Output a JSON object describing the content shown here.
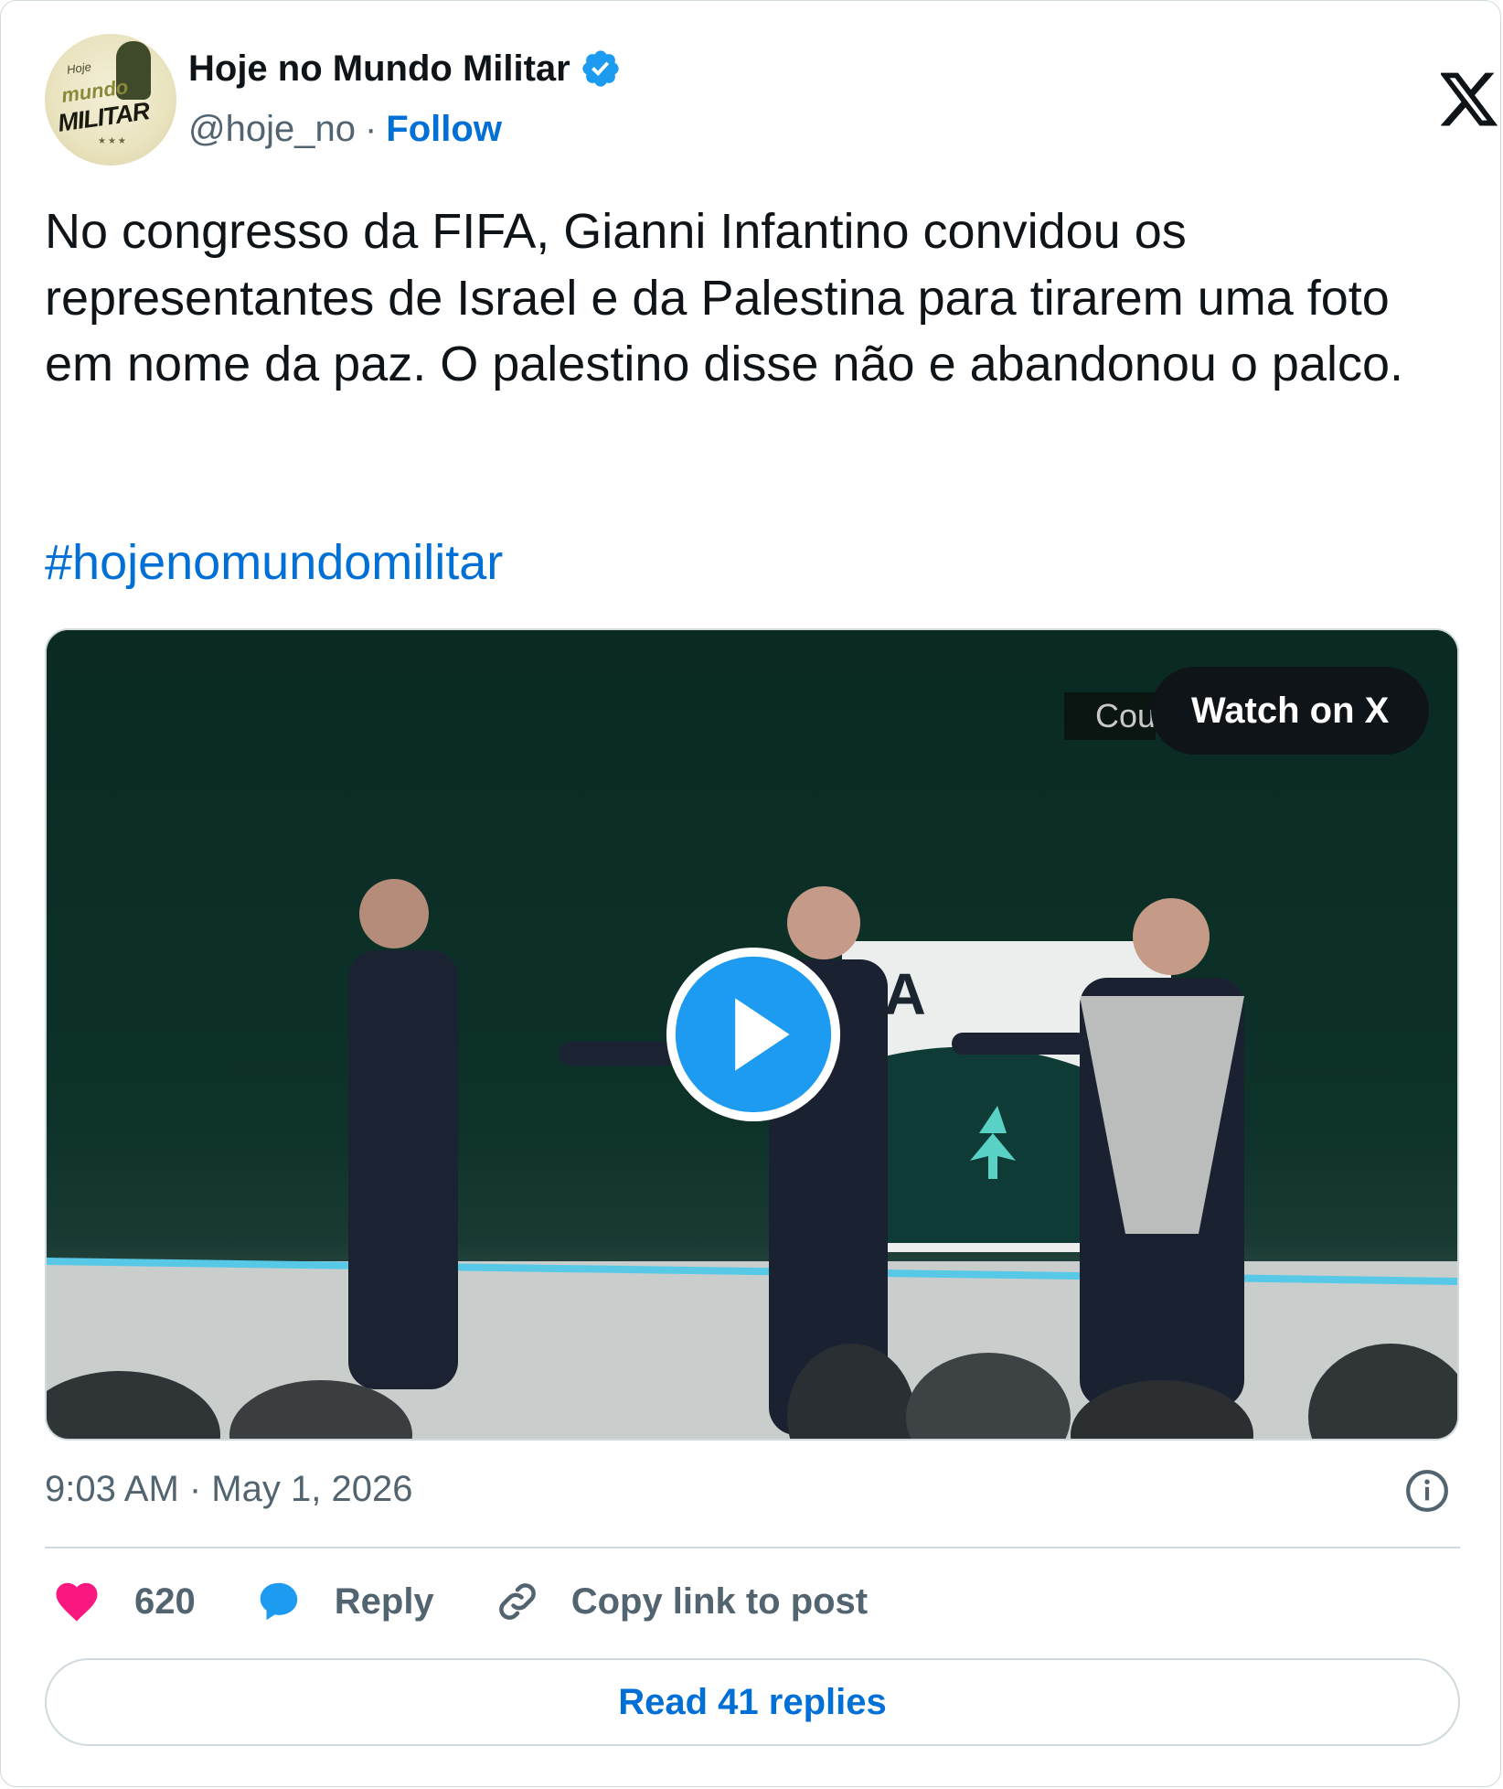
{
  "author": {
    "name": "Hoje no Mundo Militar",
    "handle": "@hoje_no",
    "separator": "·",
    "follow_label": "Follow",
    "avatar_text": [
      "Hoje",
      "mundo",
      "MILITAR"
    ],
    "verified": true
  },
  "post": {
    "text": "No congresso da FIFA, Gianni Infantino convidou os representantes de Israel e da Palestina para tirarem uma foto em nome da paz. O palestino disse não e abandonou o palco.",
    "hashtag": "#hojenomundomilitar",
    "timestamp": "9:03 AM · May 1, 2026"
  },
  "media": {
    "watch_label": "Watch on X",
    "partial_caption": "Cou",
    "stage_sign": "FA"
  },
  "actions": {
    "like_count": "620",
    "reply_label": "Reply",
    "copy_label": "Copy link to post"
  },
  "footer": {
    "read_replies_label": "Read 41 replies"
  },
  "colors": {
    "accent": "#006fd6",
    "verified": "#1d9bf0",
    "like": "#f91880",
    "text": "#0f1419",
    "muted": "#536471",
    "border": "#cfd9de"
  },
  "icons": [
    "verified-badge-icon",
    "x-logo-icon",
    "play-icon",
    "info-icon",
    "heart-icon",
    "reply-bubble-icon",
    "link-icon"
  ]
}
